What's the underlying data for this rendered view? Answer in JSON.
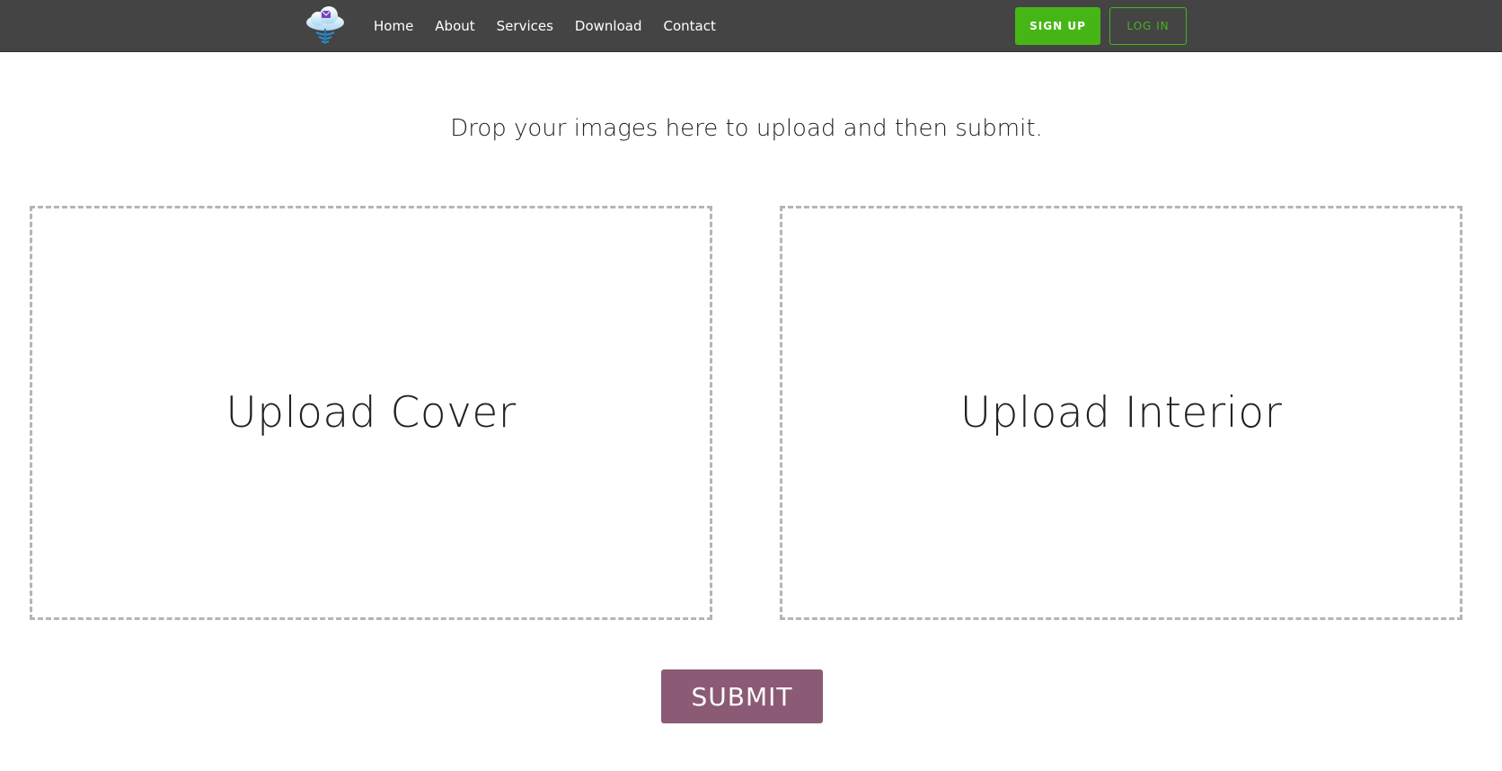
{
  "navbar": {
    "logo_icon": "cloud-mail-icon",
    "links": [
      "Home",
      "About",
      "Services",
      "Download",
      "Contact"
    ],
    "signup_label": "SIGN UP",
    "login_label": "LOG IN"
  },
  "main": {
    "headline": "Drop your images here to upload and then submit.",
    "dropzones": {
      "cover_label": "Upload Cover",
      "interior_label": "Upload Interior"
    },
    "submit_label": "SUBMIT"
  },
  "colors": {
    "navbar_bg": "#444444",
    "accent_green": "#46b617",
    "submit_bg": "#8b5a75",
    "dropzone_border": "#b5b5b5"
  }
}
